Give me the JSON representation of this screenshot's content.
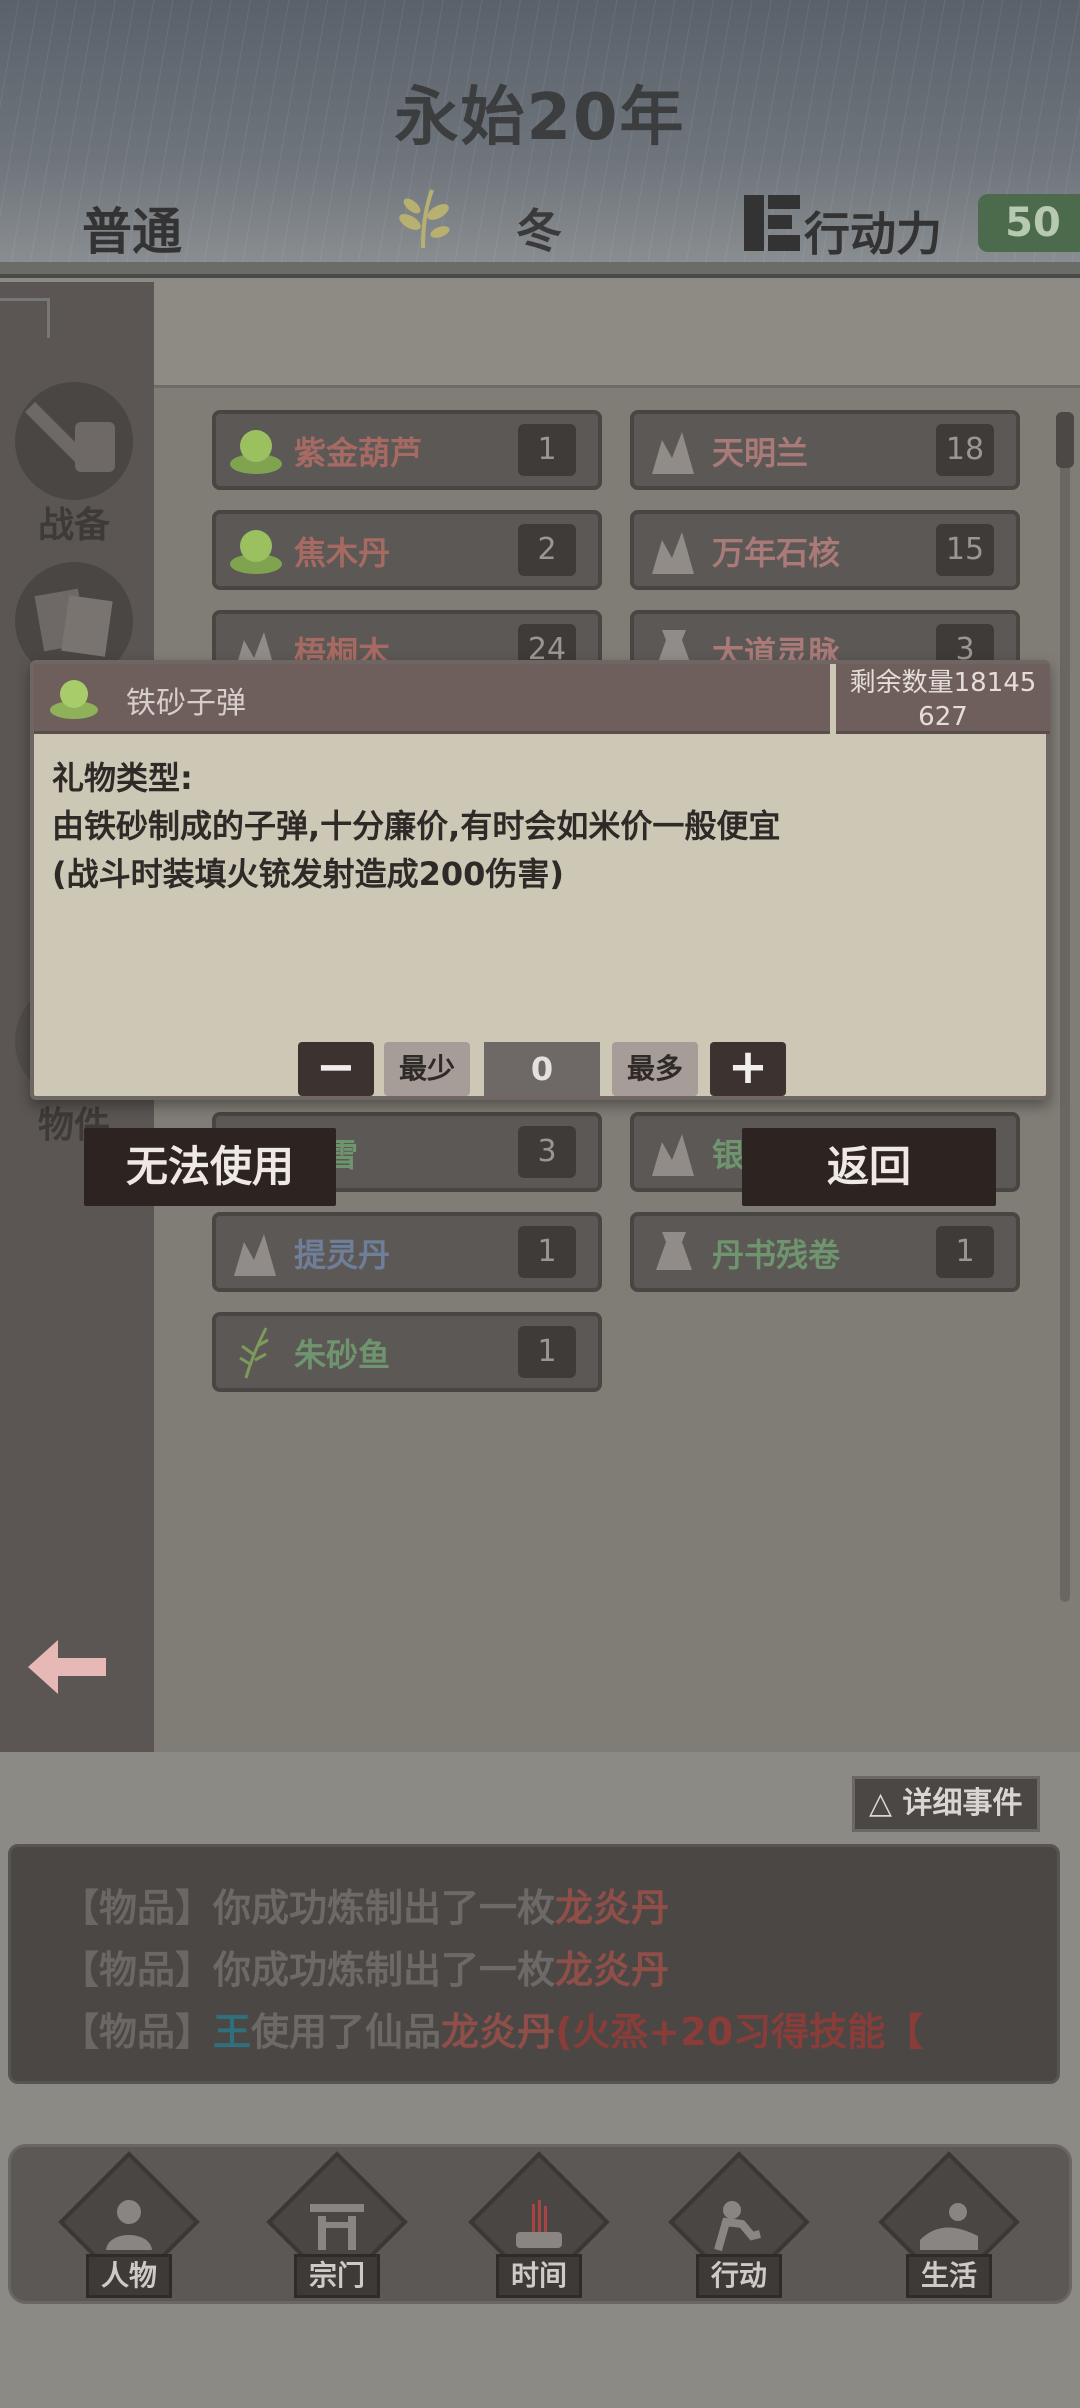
{
  "header": {
    "year": "永始20年",
    "mode": "普通",
    "season": "冬",
    "action_points_label": "行动力",
    "action_points_value": "50"
  },
  "leftnav": {
    "items": [
      {
        "label": "战备",
        "icon": "sword-shield-icon"
      },
      {
        "label": "",
        "icon": "scroll-icon"
      },
      {
        "label": "物件",
        "icon": "bag-icon"
      }
    ]
  },
  "items": [
    {
      "name": "紫金葫芦",
      "count": "1",
      "color": "red",
      "icon": "green-pill-icon"
    },
    {
      "name": "天明兰",
      "count": "18",
      "color": "pink",
      "icon": "crystal-icon"
    },
    {
      "name": "焦木丹",
      "count": "2",
      "color": "red",
      "icon": "green-pill-icon"
    },
    {
      "name": "万年石核",
      "count": "15",
      "color": "pink",
      "icon": "crystal-icon"
    },
    {
      "name": "梧桐木",
      "count": "24",
      "color": "red",
      "icon": "crystal-icon"
    },
    {
      "name": "大道灵脉",
      "count": "3",
      "color": "pink",
      "icon": "bag-icon"
    },
    {
      "name": "霜雪",
      "count": "3",
      "color": "green",
      "icon": "crystal-icon"
    },
    {
      "name": "银",
      "count": "",
      "color": "green",
      "icon": "crystal-icon"
    },
    {
      "name": "提灵丹",
      "count": "1",
      "color": "blue",
      "icon": "crystal-icon"
    },
    {
      "name": "丹书残卷",
      "count": "1",
      "color": "green",
      "icon": "bag-icon"
    },
    {
      "name": "朱砂鱼",
      "count": "1",
      "color": "green",
      "icon": "herb-icon"
    }
  ],
  "modal": {
    "item_name": "铁砂子弹",
    "remain_label": "剩余数量18145",
    "remain_value": "627",
    "type_line": "礼物类型:",
    "desc_line1": "由铁砂制成的子弹,十分廉价,有时会如米价一般便宜",
    "desc_line2": "(战斗时装填火铳发射造成200伤害)",
    "min_label": "最少",
    "max_label": "最多",
    "quantity": "0",
    "minus": "−",
    "plus": "+",
    "cannot_use": "无法使用",
    "back": "返回"
  },
  "log": {
    "detail_button": "△ 详细事件",
    "lines": [
      {
        "tag": "【物品】",
        "text": "你成功炼制出了一枚",
        "item": "龙炎丹"
      },
      {
        "tag": "【物品】",
        "text": "你成功炼制出了一枚",
        "item": "龙炎丹"
      },
      {
        "tag": "【物品】",
        "who": "王",
        "text": "使用了仙品",
        "item": "龙炎丹",
        "effect": "(火烝+20习得技能【"
      }
    ]
  },
  "tabs": [
    {
      "label": "人物",
      "icon": "person-icon"
    },
    {
      "label": "宗门",
      "icon": "gate-icon"
    },
    {
      "label": "时间",
      "icon": "incense-icon"
    },
    {
      "label": "行动",
      "icon": "action-icon"
    },
    {
      "label": "生活",
      "icon": "landscape-icon"
    }
  ],
  "colors": {
    "accent_green": "#4c6b4c",
    "modal_bg": "#cdc8b5",
    "button_dark": "#2d2422"
  }
}
